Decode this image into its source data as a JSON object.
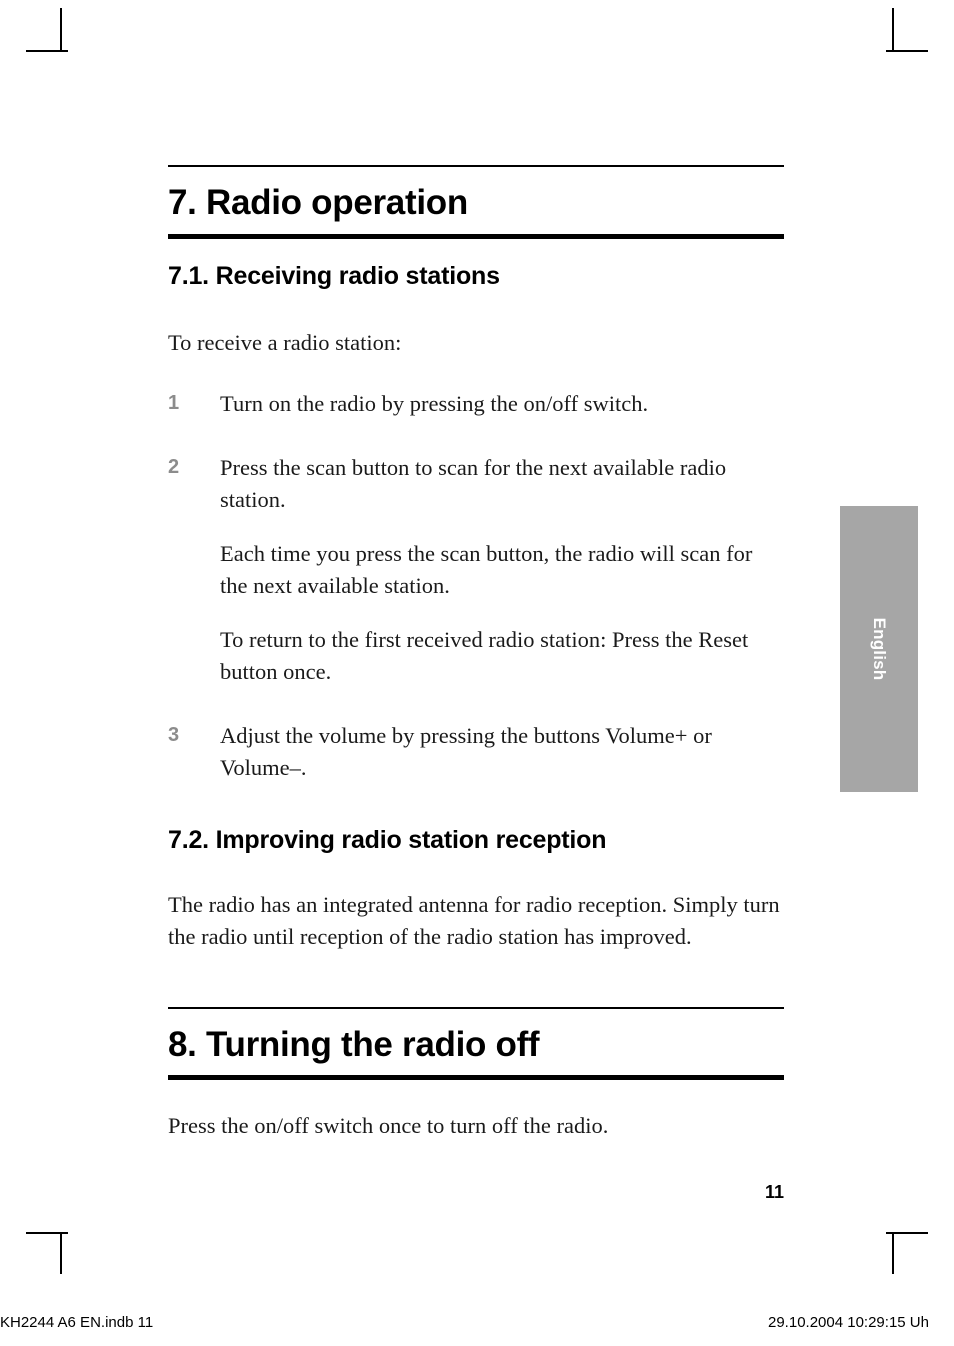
{
  "side_tab": {
    "label": "English",
    "color": "#a6a6a6"
  },
  "chapter7": {
    "title": "7. Radio operation",
    "section1": {
      "heading": "7.1. Receiving radio stations",
      "intro": "To receive a radio station:",
      "steps": [
        {
          "number": "1",
          "paragraphs": [
            "Turn on the radio by pressing the on/off switch."
          ]
        },
        {
          "number": "2",
          "paragraphs": [
            "Press the scan button to scan for the next available radio station.",
            "Each time you press the scan button, the radio will scan for the next available station.",
            "To return to the first received radio station: Press the Reset button once."
          ]
        },
        {
          "number": "3",
          "paragraphs": [
            "Adjust the volume by pressing the buttons Volume+ or Volume–."
          ]
        }
      ]
    },
    "section2": {
      "heading": "7.2. Improving radio station reception",
      "body": "The radio has an integrated antenna for radio reception. Simply turn the radio until reception of the radio station has improved."
    }
  },
  "chapter8": {
    "title": "8. Turning the radio off",
    "body": "Press the on/off switch once to turn off the radio."
  },
  "page_number": "11",
  "print_footer": {
    "left": "KH2244 A6 EN.indb   11",
    "right": "29.10.2004   10:29:15 Uh"
  }
}
